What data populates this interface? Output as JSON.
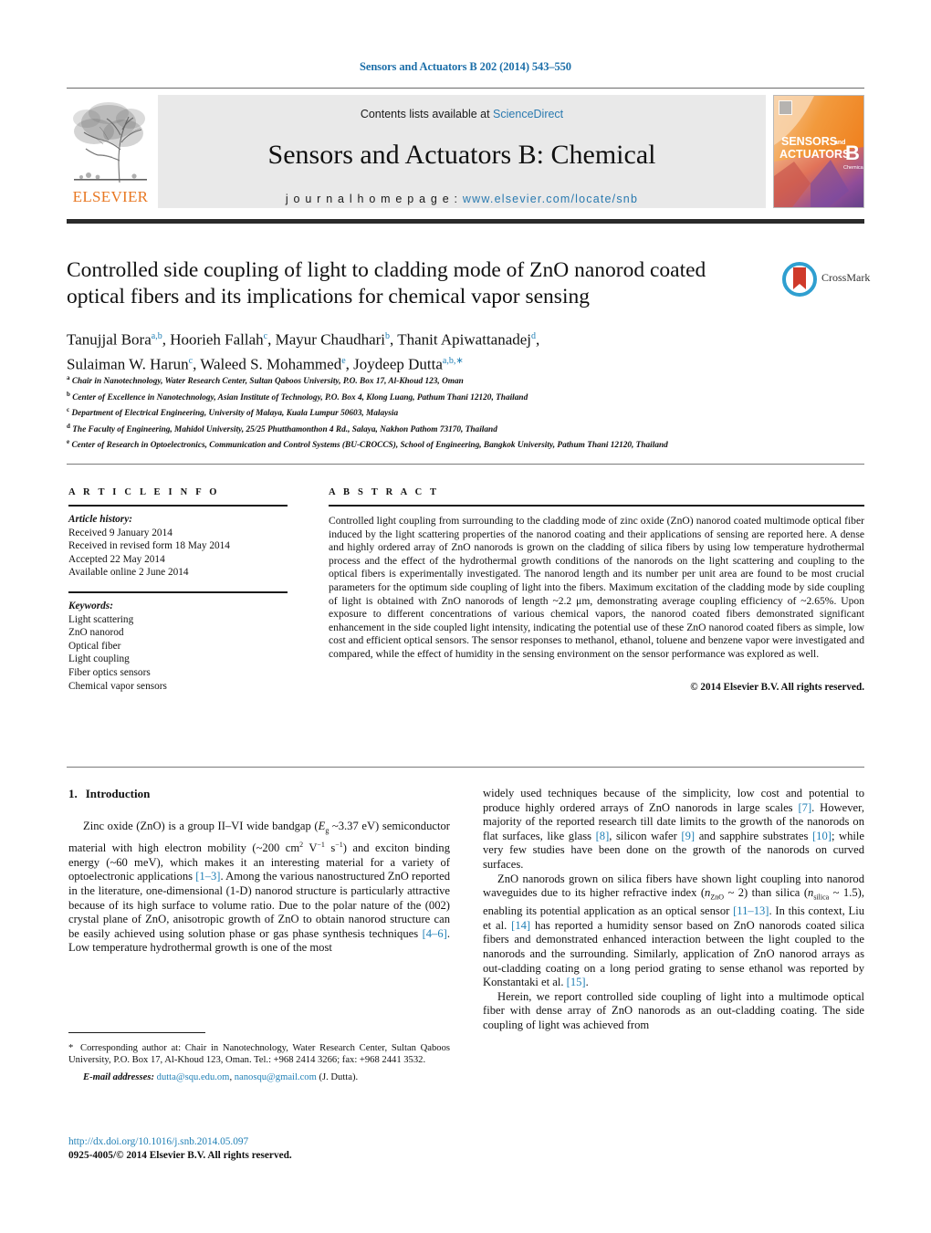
{
  "running_head": "Sensors and Actuators B 202 (2014) 543–550",
  "masthead": {
    "publisher": "ELSEVIER",
    "contents_prefix": "Contents lists available at ",
    "contents_link": "ScienceDirect",
    "journal_title": "Sensors and Actuators B: Chemical",
    "homepage_label": "j o u r n a l   h o m e p a g e :",
    "homepage_url": "www.elsevier.com/locate/snb",
    "cover_line1": "SENSORS",
    "cover_and": "and",
    "cover_line2": "ACTUATORS",
    "cover_letter": "B",
    "cover_sub": "Chemical",
    "bg_orange": "#ef7d1a",
    "link_blue": "#2a7ab0"
  },
  "crossmark": {
    "label": "CrossMark",
    "ring_color": "#2f9fd0",
    "mark_color": "#cf3a2a"
  },
  "article": {
    "title": "Controlled side coupling of light to cladding mode of ZnO nanorod coated optical fibers and its implications for chemical vapor sensing",
    "authors_line1_parts": [
      {
        "name": "Tanujjal Bora",
        "sup": "a,b"
      },
      {
        "name": "Hoorieh Fallah",
        "sup": "c"
      },
      {
        "name": "Mayur Chaudhari",
        "sup": "b"
      },
      {
        "name": "Thanit Apiwattanadej",
        "sup": "d"
      }
    ],
    "authors_line2_parts": [
      {
        "name": "Sulaiman W. Harun",
        "sup": "c"
      },
      {
        "name": "Waleed S. Mohammed",
        "sup": "e"
      },
      {
        "name": "Joydeep Dutta",
        "sup": "a,b,∗"
      }
    ],
    "affiliations": [
      {
        "mark": "a",
        "text": "Chair in Nanotechnology, Water Research Center, Sultan Qaboos University, P.O. Box 17, Al-Khoud 123, Oman"
      },
      {
        "mark": "b",
        "text": "Center of Excellence in Nanotechnology, Asian Institute of Technology, P.O. Box 4, Klong Luang, Pathum Thani 12120, Thailand"
      },
      {
        "mark": "c",
        "text": "Department of Electrical Engineering, University of Malaya, Kuala Lumpur 50603, Malaysia"
      },
      {
        "mark": "d",
        "text": "The Faculty of Engineering, Mahidol University, 25/25 Phutthamonthon 4 Rd., Salaya, Nakhon Pathom 73170, Thailand"
      },
      {
        "mark": "e",
        "text": "Center of Research in Optoelectronics, Communication and Control Systems (BU-CROCCS), School of Engineering, Bangkok University, Pathum Thani 12120, Thailand"
      }
    ]
  },
  "article_info": {
    "heading": "A R T I C L E    I N F O",
    "history_label": "Article history:",
    "history": [
      "Received 9 January 2014",
      "Received in revised form 18 May 2014",
      "Accepted 22 May 2014",
      "Available online 2 June 2014"
    ],
    "keywords_label": "Keywords:",
    "keywords": [
      "Light scattering",
      "ZnO nanorod",
      "Optical fiber",
      "Light coupling",
      "Fiber optics sensors",
      "Chemical vapor sensors"
    ]
  },
  "abstract": {
    "heading": "A B S T R A C T",
    "text": "Controlled light coupling from surrounding to the cladding mode of zinc oxide (ZnO) nanorod coated multimode optical fiber induced by the light scattering properties of the nanorod coating and their applications of sensing are reported here. A dense and highly ordered array of ZnO nanorods is grown on the cladding of silica fibers by using low temperature hydrothermal process and the effect of the hydrothermal growth conditions of the nanorods on the light scattering and coupling to the optical fibers is experimentally investigated. The nanorod length and its number per unit area are found to be most crucial parameters for the optimum side coupling of light into the fibers. Maximum excitation of the cladding mode by side coupling of light is obtained with ZnO nanorods of length ~2.2 μm, demonstrating average coupling efficiency of ~2.65%. Upon exposure to different concentrations of various chemical vapors, the nanorod coated fibers demonstrated significant enhancement in the side coupled light intensity, indicating the potential use of these ZnO nanorod coated fibers as simple, low cost and efficient optical sensors. The sensor responses to methanol, ethanol, toluene and benzene vapor were investigated and compared, while the effect of humidity in the sensing environment on the sensor performance was explored as well.",
    "copyright": "© 2014 Elsevier B.V. All rights reserved."
  },
  "body": {
    "section_number": "1.",
    "section_title": "Introduction",
    "left_p1_a": "Zinc oxide (ZnO) is a group II–VI wide bandgap (",
    "left_p1_eg": "E",
    "left_p1_eg_sub": "g",
    "left_p1_b": " ~3.37 eV) semiconductor material with high electron mobility (~200 cm",
    "left_p1_c": " V",
    "left_p1_d": " s",
    "left_p1_e": ") and exciton binding energy (~60 meV), which makes it an interesting material for a variety of optoelectronic applications ",
    "left_p1_ref1": "[1–3]",
    "left_p1_f": ". Among the various nanostructured ZnO reported in the literature, one-dimensional (1-D) nanorod structure is particularly attractive because of its high surface to volume ratio. Due to the polar nature of the (002) crystal plane of ZnO, anisotropic growth of ZnO to obtain nanorod structure can be easily achieved using solution phase or gas phase synthesis techniques ",
    "left_p1_ref2": "[4–6]",
    "left_p1_g": ". Low temperature hydrothermal growth is one of the most",
    "right_p1_a": "widely used techniques because of the simplicity, low cost and potential to produce highly ordered arrays of ZnO nanorods in large scales ",
    "right_p1_ref1": "[7]",
    "right_p1_b": ". However, majority of the reported research till date limits to the growth of the nanorods on flat surfaces, like glass ",
    "right_p1_ref2": "[8]",
    "right_p1_c": ", silicon wafer ",
    "right_p1_ref3": "[9]",
    "right_p1_d": " and sapphire substrates ",
    "right_p1_ref4": "[10]",
    "right_p1_e": "; while very few studies have been done on the growth of the nanorods on curved surfaces.",
    "right_p2_a": "ZnO nanorods grown on silica fibers have shown light coupling into nanorod waveguides due to its higher refractive index (",
    "right_p2_n1": "n",
    "right_p2_n1_sub": "ZnO",
    "right_p2_b": " ~ 2) than silica (",
    "right_p2_n2": "n",
    "right_p2_n2_sub": "silica",
    "right_p2_c": " ~ 1.5), enabling its potential application as an optical sensor ",
    "right_p2_ref1": "[11–13]",
    "right_p2_d": ". In this context, Liu et al. ",
    "right_p2_ref2": "[14]",
    "right_p2_e": " has reported a humidity sensor based on ZnO nanorods coated silica fibers and demonstrated enhanced interaction between the light coupled to the nanorods and the surrounding. Similarly, application of ZnO nanorod arrays as out-cladding coating on a long period grating to sense ethanol was reported by Konstantaki et al. ",
    "right_p2_ref3": "[15]",
    "right_p2_f": ".",
    "right_p3": "Herein, we report controlled side coupling of light into a multimode optical fiber with dense array of ZnO nanorods as an out-cladding coating. The side coupling of light was achieved from"
  },
  "footnote": {
    "star": "*",
    "text": " Corresponding author at: Chair in Nanotechnology, Water Research Center, Sultan Qaboos University, P.O. Box 17, Al-Khoud 123, Oman. Tel.: +968 2414 3266; fax: +968 2441 3532.",
    "email_label": "E-mail addresses:",
    "email1": "dutta@squ.edu.om",
    "email_sep": ", ",
    "email2": "nanosqu@gmail.com",
    "email_suffix": " (J. Dutta)."
  },
  "footer": {
    "doi": "http://dx.doi.org/10.1016/j.snb.2014.05.097",
    "issn_line": "0925-4005/© 2014 Elsevier B.V. All rights reserved."
  }
}
